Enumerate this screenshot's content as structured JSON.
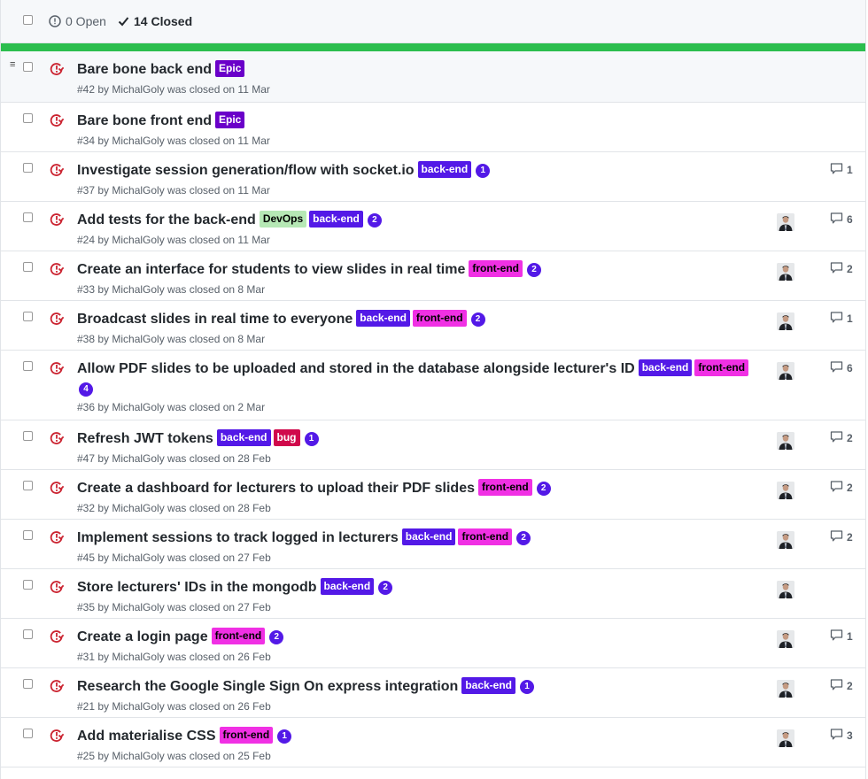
{
  "header": {
    "open_label": "0 Open",
    "closed_label": "14 Closed"
  },
  "labels": {
    "Epic": {
      "bg": "#6a00c9",
      "fg": "#ffffff"
    },
    "back-end": {
      "bg": "#5319e7",
      "fg": "#ffffff"
    },
    "front-end": {
      "bg": "#f030e4",
      "fg": "#000000"
    },
    "DevOps": {
      "bg": "#b6e8b5",
      "fg": "#000000"
    },
    "bug": {
      "bg": "#d0094b",
      "fg": "#ffffff"
    }
  },
  "colors": {
    "closed_icon": "#cb2431",
    "progress": "#2cbe4e",
    "count_badge": "#5319e7"
  },
  "issues": [
    {
      "title": "Bare bone back end",
      "labels": [
        "Epic"
      ],
      "count": "",
      "meta": "#42 by MichalGoly was closed on 11 Mar",
      "avatar": false,
      "comments": ""
    },
    {
      "title": "Bare bone front end",
      "labels": [
        "Epic"
      ],
      "count": "",
      "meta": "#34 by MichalGoly was closed on 11 Mar",
      "avatar": false,
      "comments": ""
    },
    {
      "title": "Investigate session generation/flow with socket.io",
      "labels": [
        "back-end"
      ],
      "count": "1",
      "meta": "#37 by MichalGoly was closed on 11 Mar",
      "avatar": false,
      "comments": "1"
    },
    {
      "title": "Add tests for the back-end",
      "labels": [
        "DevOps",
        "back-end"
      ],
      "count": "2",
      "meta": "#24 by MichalGoly was closed on 11 Mar",
      "avatar": true,
      "comments": "6"
    },
    {
      "title": "Create an interface for students to view slides in real time",
      "labels": [
        "front-end"
      ],
      "count": "2",
      "meta": "#33 by MichalGoly was closed on 8 Mar",
      "avatar": true,
      "comments": "2"
    },
    {
      "title": "Broadcast slides in real time to everyone",
      "labels": [
        "back-end",
        "front-end"
      ],
      "count": "2",
      "meta": "#38 by MichalGoly was closed on 8 Mar",
      "avatar": true,
      "comments": "1"
    },
    {
      "title": "Allow PDF slides to be uploaded and stored in the database alongside lecturer's ID",
      "labels": [
        "back-end",
        "front-end"
      ],
      "count": "4",
      "meta": "#36 by MichalGoly was closed on 2 Mar",
      "avatar": true,
      "comments": "6"
    },
    {
      "title": "Refresh JWT tokens",
      "labels": [
        "back-end",
        "bug"
      ],
      "count": "1",
      "meta": "#47 by MichalGoly was closed on 28 Feb",
      "avatar": true,
      "comments": "2"
    },
    {
      "title": "Create a dashboard for lecturers to upload their PDF slides",
      "labels": [
        "front-end"
      ],
      "count": "2",
      "meta": "#32 by MichalGoly was closed on 28 Feb",
      "avatar": true,
      "comments": "2"
    },
    {
      "title": "Implement sessions to track logged in lecturers",
      "labels": [
        "back-end",
        "front-end"
      ],
      "count": "2",
      "meta": "#45 by MichalGoly was closed on 27 Feb",
      "avatar": true,
      "comments": "2"
    },
    {
      "title": "Store lecturers' IDs in the mongodb",
      "labels": [
        "back-end"
      ],
      "count": "2",
      "meta": "#35 by MichalGoly was closed on 27 Feb",
      "avatar": true,
      "comments": ""
    },
    {
      "title": "Create a login page",
      "labels": [
        "front-end"
      ],
      "count": "2",
      "meta": "#31 by MichalGoly was closed on 26 Feb",
      "avatar": true,
      "comments": "1"
    },
    {
      "title": "Research the Google Single Sign On express integration",
      "labels": [
        "back-end"
      ],
      "count": "1",
      "meta": "#21 by MichalGoly was closed on 26 Feb",
      "avatar": true,
      "comments": "2"
    },
    {
      "title": "Add materialise CSS",
      "labels": [
        "front-end"
      ],
      "count": "1",
      "meta": "#25 by MichalGoly was closed on 25 Feb",
      "avatar": true,
      "comments": "3"
    }
  ]
}
